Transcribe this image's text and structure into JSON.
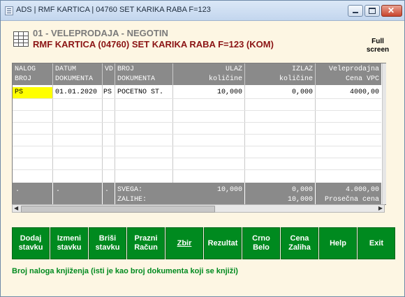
{
  "window": {
    "title": "ADS | RMF KARTICA | 04760  SET KARIKA RABA F=123"
  },
  "header": {
    "line1": "01 - VELEPRODAJA - NEGOTIN",
    "line2": "RMF KARTICA (04760) SET KARIKA RABA F=123 (KOM)",
    "fullscreen_label": "Full\nscreen"
  },
  "table": {
    "columns": [
      {
        "line1": "NALOG",
        "line2": "BROJ",
        "align": "left"
      },
      {
        "line1": "DATUM",
        "line2": "DOKUMENTA",
        "align": "left"
      },
      {
        "line1": "VD",
        "line2": "",
        "align": "left"
      },
      {
        "line1": "BROJ",
        "line2": "DOKUMENTA",
        "align": "left"
      },
      {
        "line1": "ULAZ",
        "line2": "količine",
        "align": "right"
      },
      {
        "line1": "IZLAZ",
        "line2": "količine",
        "align": "right"
      },
      {
        "line1": "Veleprodajna",
        "line2": "Cena VPC",
        "align": "right"
      }
    ],
    "rows": [
      {
        "nalog": "PS",
        "datum": "01.01.2020",
        "vd": "PS",
        "broj": "POCETNO ST.",
        "ulaz": "10,000",
        "izlaz": "0,000",
        "cena": "4000,00"
      }
    ],
    "footer": {
      "c1": ".",
      "c2": ".",
      "c3": ".",
      "svega_label": "SVEGA:",
      "zalihe_label": "ZALIHE:",
      "ulaz_total": "10,000",
      "izlaz_total": "0,000",
      "zalihe_value": "10,000",
      "cena_total": "4.000,00",
      "prosecna_label": "Prosečna cena"
    }
  },
  "buttons": [
    {
      "label": "Dodaj\nstavku"
    },
    {
      "label": "Izmeni\nstavku"
    },
    {
      "label": "Briši\nstavku"
    },
    {
      "label": "Prazni\nRačun"
    },
    {
      "label": "Zbir"
    },
    {
      "label": "Rezultat"
    },
    {
      "label": "Crno\nBelo"
    },
    {
      "label": "Cena\nZaliha"
    },
    {
      "label": "Help"
    },
    {
      "label": "Exit"
    }
  ],
  "status": "Broj naloga knjiženja (isti je kao broj dokumenta koji se knjiži)",
  "colors": {
    "button_green": "#008a1f",
    "header_red": "#8b1414",
    "selected_cell": "#ffff00",
    "grid_header": "#8a8a8a"
  }
}
